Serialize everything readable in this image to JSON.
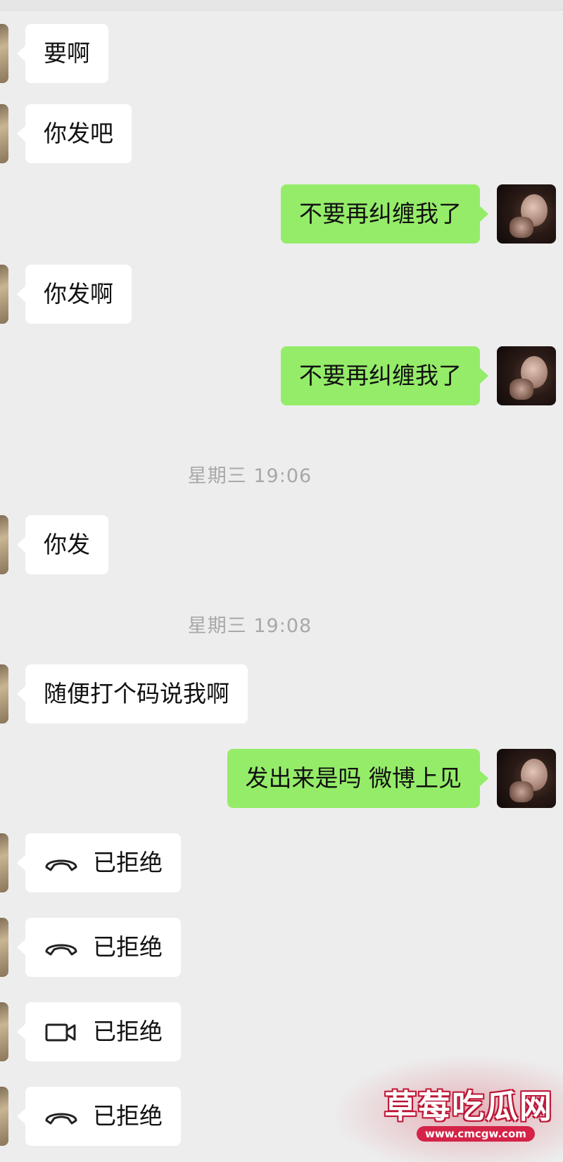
{
  "messages": [
    {
      "dir": "in",
      "text": "要啊"
    },
    {
      "dir": "in",
      "text": "你发吧"
    },
    {
      "dir": "out",
      "text": "不要再纠缠我了"
    },
    {
      "dir": "in",
      "text": "你发啊"
    },
    {
      "dir": "out",
      "text": "不要再纠缠我了"
    },
    {
      "timestamp": "星期三 19:06"
    },
    {
      "dir": "in",
      "text": "你发"
    },
    {
      "timestamp": "星期三 19:08"
    },
    {
      "dir": "in",
      "text": "随便打个码说我啊"
    },
    {
      "dir": "out",
      "text": "发出来是吗 微博上见"
    },
    {
      "dir": "in",
      "call": "voice",
      "icon": "phone-hangup-icon",
      "text": "已拒绝"
    },
    {
      "dir": "in",
      "call": "voice",
      "icon": "phone-hangup-icon",
      "text": "已拒绝"
    },
    {
      "dir": "in",
      "call": "video",
      "icon": "video-camera-icon",
      "text": "已拒绝"
    },
    {
      "dir": "in",
      "call": "voice",
      "icon": "phone-hangup-icon",
      "text": "已拒绝"
    }
  ],
  "watermark": {
    "title": "草莓吃瓜网",
    "url": "www.cmcgw.com"
  },
  "colors": {
    "background": "#ededed",
    "incoming_bubble": "#ffffff",
    "outgoing_bubble": "#95ec69",
    "timestamp": "#a8a8a8",
    "watermark": "#c2183a"
  }
}
